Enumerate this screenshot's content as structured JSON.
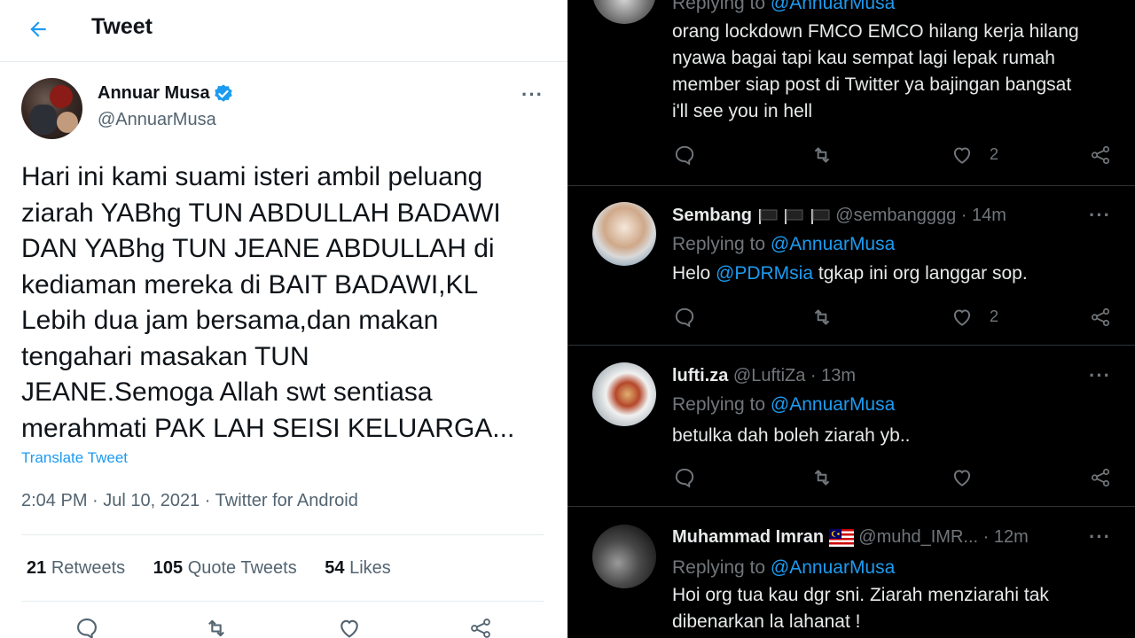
{
  "left": {
    "header": {
      "title": "Tweet"
    },
    "author": {
      "name": "Annuar Musa",
      "handle": "@AnnuarMusa"
    },
    "tweet": {
      "text": "Hari ini kami suami isteri ambil peluang\nziarah YABhg TUN ABDULLAH BADAWI\nDAN YABhg TUN JEANE ABDULLAH di\nkediaman mereka di BAIT BADAWI,KL\nLebih dua jam bersama,dan makan\ntengahari masakan TUN\nJEANE.Semoga Allah swt sentiasa\nmerahmati PAK LAH SEISI KELUARGA...",
      "translate_label": "Translate Tweet",
      "meta": "2:04 PM · Jul 10, 2021 · Twitter for Android"
    },
    "stats": [
      {
        "count": "21",
        "label": "Retweets"
      },
      {
        "count": "105",
        "label": "Quote Tweets"
      },
      {
        "count": "54",
        "label": "Likes"
      }
    ]
  },
  "right": {
    "replies": [
      {
        "replying_prefix": "Replying to",
        "replying_mention": "@AnnuarMusa",
        "text_lines": [
          "orang lockdown FMCO EMCO hilang kerja hilang",
          "nyawa bagai tapi kau sempat lagi lepak rumah",
          "member siap post di Twitter ya bajingan bangsat",
          "i'll see you in hell"
        ],
        "like_count": "2"
      },
      {
        "name": "Sembang",
        "handle_time": "@sembangggg · 14m",
        "replying_prefix": "Replying to",
        "replying_mention": "@AnnuarMusa",
        "text_prefix": "Helo ",
        "text_mention": "@PDRMsia",
        "text_suffix": " tgkap ini org langgar sop.",
        "like_count": "2"
      },
      {
        "name": "lufti.za",
        "handle_time": "@LuftiZa · 13m",
        "replying_prefix": "Replying to",
        "replying_mention": "@AnnuarMusa",
        "text": "betulka dah boleh ziarah yb.."
      },
      {
        "name": "Muhammad Imran",
        "handle_time": "@muhd_IMR... · 12m",
        "replying_prefix": "Replying to",
        "replying_mention": "@AnnuarMusa",
        "text_lines": [
          "Hoi org tua kau dgr sni. Ziarah menziarahi tak",
          "dibenarkan la lahanat !"
        ]
      }
    ]
  },
  "colors": {
    "accent": "#1d9bf0",
    "light_text": "#0f1419",
    "light_secondary": "#536471",
    "dark_text": "#e7e9ea",
    "dark_secondary": "#71767b",
    "dark_border": "#2f3336"
  },
  "icons": {
    "back": "arrow-left-icon",
    "verified": "verified-badge-icon",
    "more": "more-horizontal-icon",
    "reply": "reply-icon",
    "retweet": "retweet-icon",
    "like": "heart-icon",
    "share": "share-icon",
    "flag_malaysia": "malaysia-flag-icon",
    "flag_black": "black-flag-icon"
  }
}
